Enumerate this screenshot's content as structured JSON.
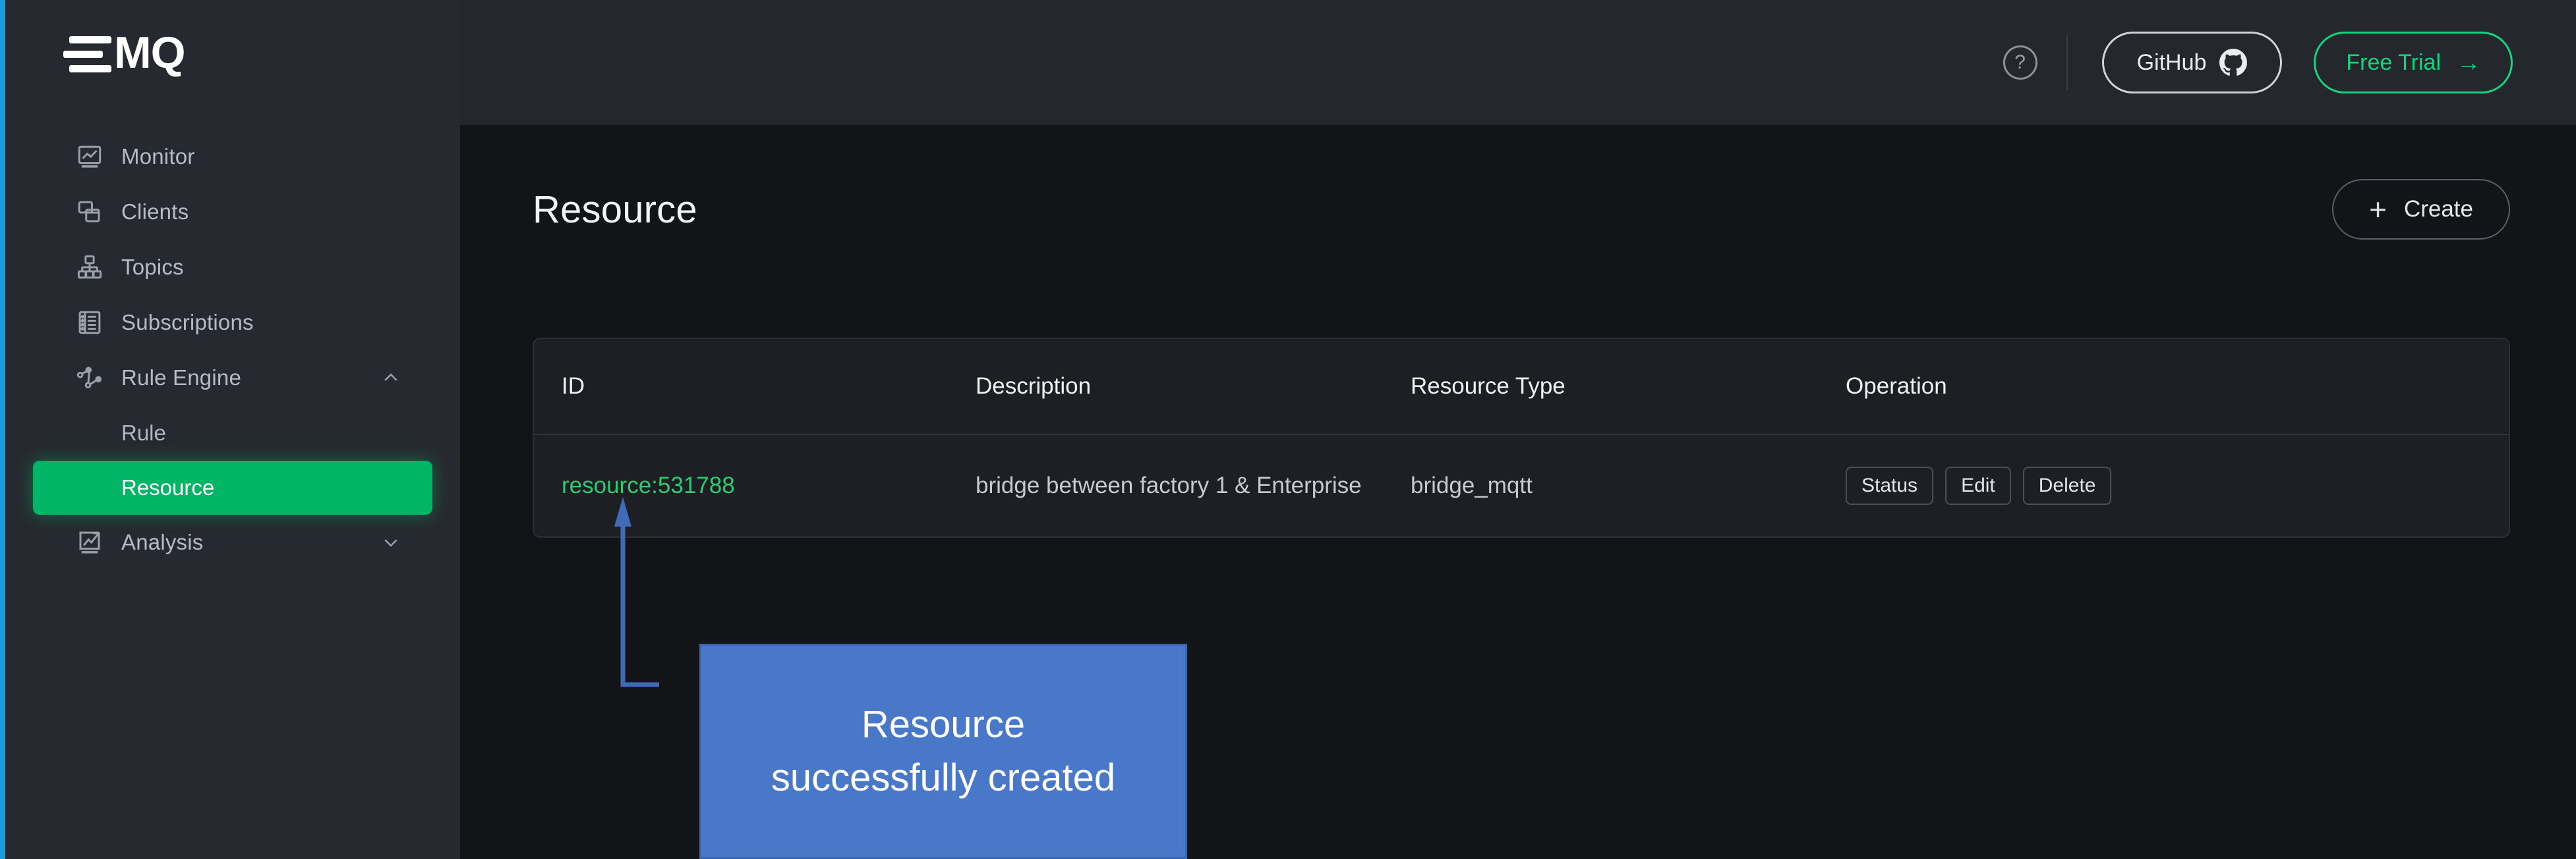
{
  "brand": {
    "logo_text": "MQ",
    "accent_green": "#00b566",
    "accent_blue_strip": "#1d9bdd",
    "link_green": "#2ecc71",
    "callout_blue": "#4a78c8"
  },
  "topbar": {
    "help_icon": "question-circle-icon",
    "github_label": "GitHub",
    "github_icon": "github-icon",
    "free_trial_label": "Free Trial",
    "free_trial_arrow": "→"
  },
  "sidebar": {
    "items": [
      {
        "label": "Monitor",
        "icon": "monitor-chart-icon",
        "chevron": ""
      },
      {
        "label": "Clients",
        "icon": "clients-icon",
        "chevron": ""
      },
      {
        "label": "Topics",
        "icon": "topics-tree-icon",
        "chevron": ""
      },
      {
        "label": "Subscriptions",
        "icon": "subscriptions-list-icon",
        "chevron": ""
      },
      {
        "label": "Rule Engine",
        "icon": "rule-engine-nodes-icon",
        "chevron": "chevron-up-icon"
      },
      {
        "label": "Analysis",
        "icon": "analysis-trend-icon",
        "chevron": "chevron-down-icon"
      }
    ],
    "sub_items": [
      {
        "label": "Rule",
        "active": false
      },
      {
        "label": "Resource",
        "active": true
      }
    ]
  },
  "page": {
    "title": "Resource",
    "create_label": "Create",
    "create_icon": "plus-icon"
  },
  "table": {
    "columns": [
      "ID",
      "Description",
      "Resource Type",
      "Operation"
    ],
    "rows": [
      {
        "id": "resource:531788",
        "description": "bridge between factory 1 & Enterprise",
        "resource_type": "bridge_mqtt",
        "operations": [
          "Status",
          "Edit",
          "Delete"
        ]
      }
    ]
  },
  "annotation": {
    "callout_text": "Resource\nsuccessfully created",
    "connector": "elbow-arrow-pointing-to-resource-id"
  }
}
